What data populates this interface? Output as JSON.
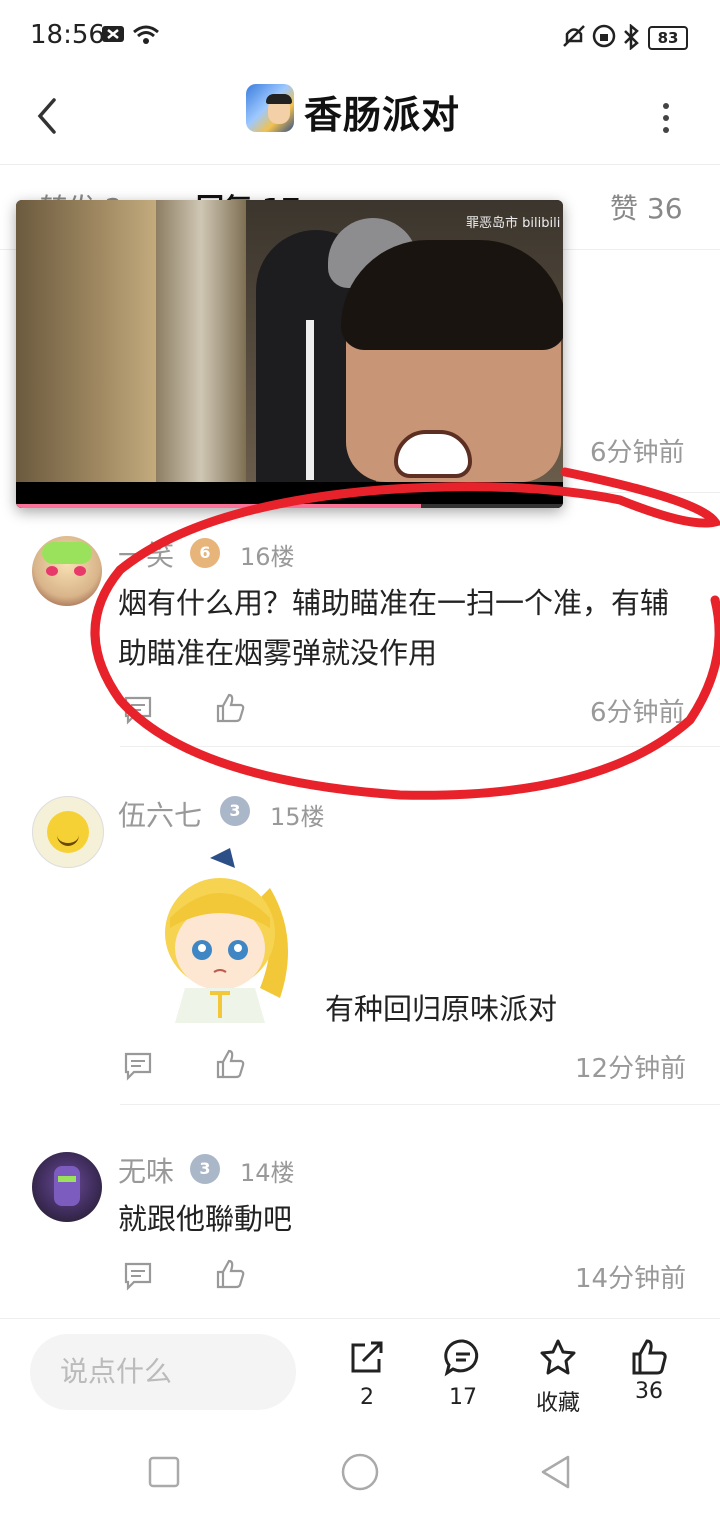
{
  "status": {
    "time": "18:56",
    "battery": "83"
  },
  "header": {
    "title": "香肠派对"
  },
  "tabs": {
    "forward": "转发 2",
    "replies": "回复 17",
    "likes": "赞 36"
  },
  "video": {
    "watermark": "罪恶岛市 bilibili",
    "progress": 0.74
  },
  "partial_comment": {
    "time": "6分钟前"
  },
  "comments": [
    {
      "user": "一笑",
      "badge": "6",
      "floor": "16楼",
      "text": "烟有什么用？辅助瞄准在一扫一个准，有辅助瞄准在烟雾弹就没作用",
      "time": "6分钟前"
    },
    {
      "user": "伍六七",
      "badge": "3",
      "floor": "15楼",
      "text": "有种回归原味派对",
      "time": "12分钟前"
    },
    {
      "user": "无味",
      "badge": "3",
      "floor": "14楼",
      "text": "就跟他聯動吧",
      "time": "14分钟前"
    }
  ],
  "bottom": {
    "placeholder": "说点什么",
    "share_count": "2",
    "comment_count": "17",
    "favorite": "收藏",
    "like_count": "36"
  },
  "colors": {
    "accent": "#fb7299",
    "annotation": "#e8222a"
  },
  "icons": [
    "back-icon",
    "more-icon",
    "comment-icon",
    "like-icon",
    "share-icon",
    "favorite-icon",
    "nav-square-icon",
    "nav-circle-icon",
    "nav-back-icon"
  ]
}
